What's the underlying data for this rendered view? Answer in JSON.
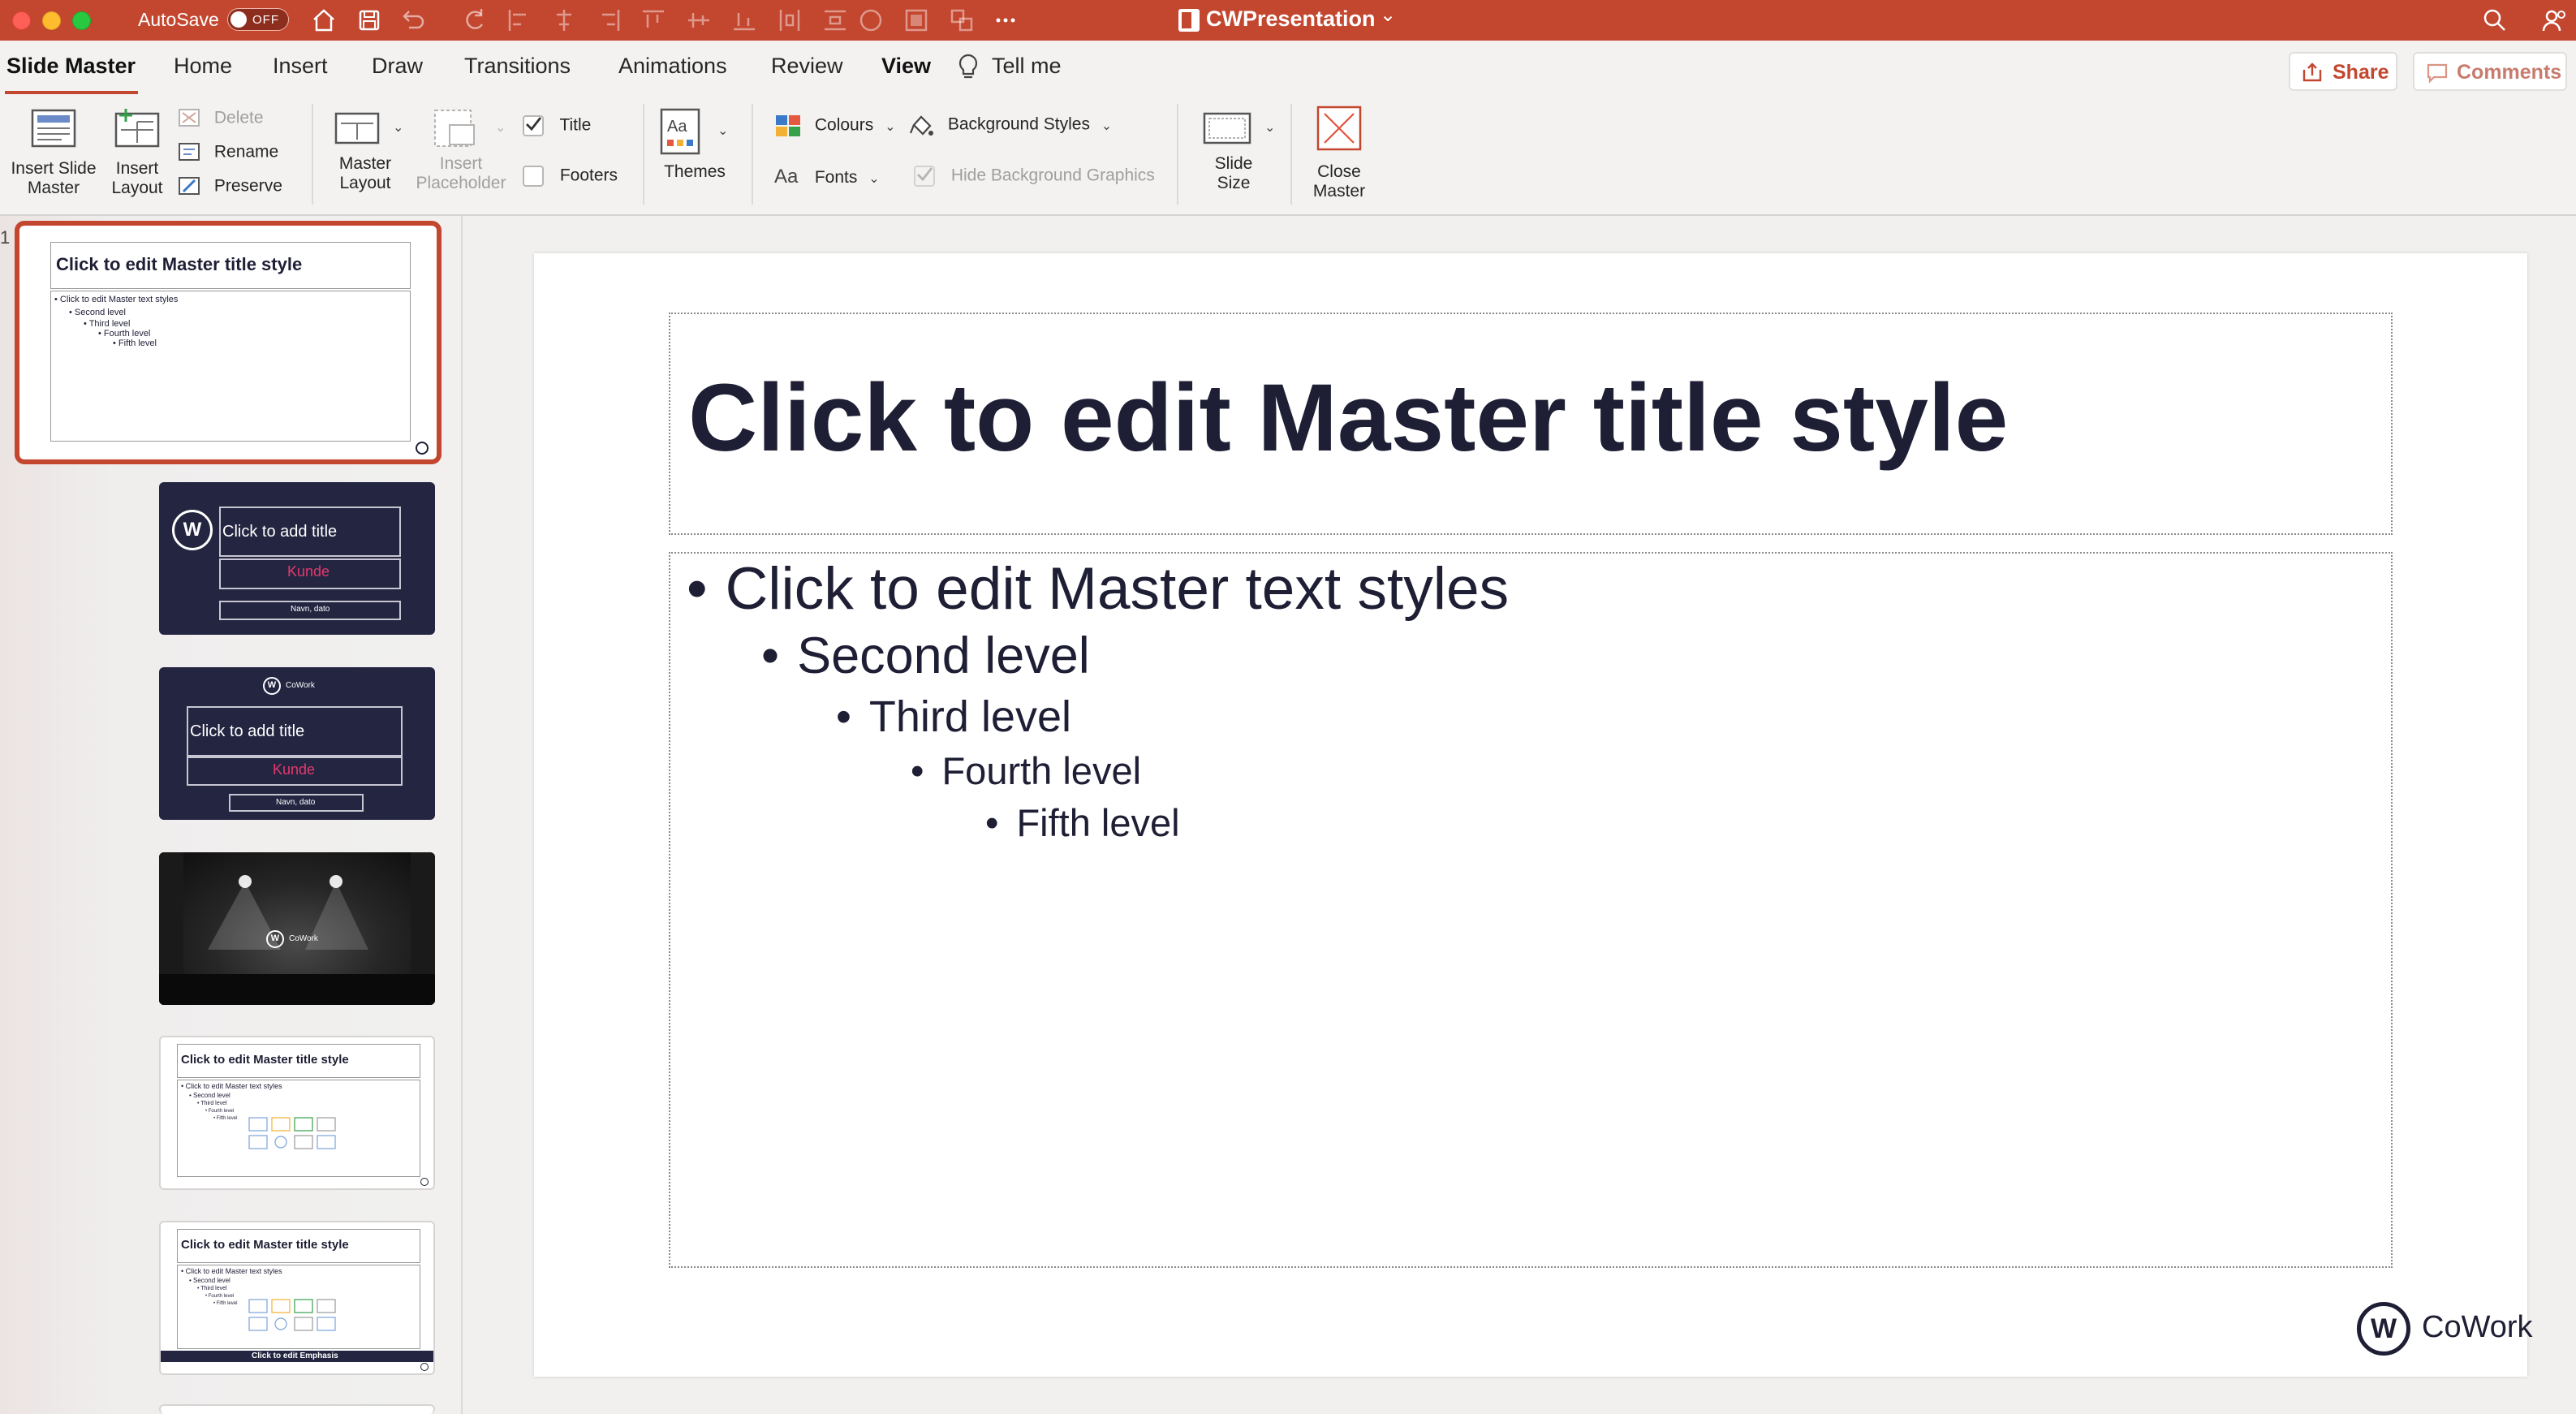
{
  "window": {
    "autosave_label": "AutoSave",
    "autosave_state": "OFF",
    "document_title": "CWPresentation",
    "title_caret": "⌄"
  },
  "tabs": [
    {
      "label": "Slide Master",
      "active": true
    },
    {
      "label": "Home"
    },
    {
      "label": "Insert"
    },
    {
      "label": "Draw"
    },
    {
      "label": "Transitions"
    },
    {
      "label": "Animations"
    },
    {
      "label": "Review"
    },
    {
      "label": "View"
    },
    {
      "label": "Tell me"
    }
  ],
  "share_label": "Share",
  "comments_label": "Comments",
  "ribbon": {
    "insert_slide_master": [
      "Insert Slide",
      "Master"
    ],
    "insert_layout": [
      "Insert",
      "Layout"
    ],
    "delete": "Delete",
    "rename": "Rename",
    "preserve": "Preserve",
    "master_layout": [
      "Master",
      "Layout"
    ],
    "insert_placeholder": [
      "Insert",
      "Placeholder"
    ],
    "title_check": "Title",
    "footers_check": "Footers",
    "themes": "Themes",
    "colours": "Colours",
    "fonts": "Fonts",
    "background_styles": "Background Styles",
    "hide_background_graphics": "Hide Background Graphics",
    "slide_size": [
      "Slide",
      "Size"
    ],
    "close_master": [
      "Close",
      "Master"
    ]
  },
  "thumbnails": {
    "slide_number": "1",
    "master": {
      "title": "Click to edit Master title style",
      "levels": [
        "• Click to edit Master text styles",
        "• Second level",
        "• Third level",
        "• Fourth level",
        "• Fifth level"
      ]
    },
    "layout2": {
      "title": "Click to add title",
      "kunde": "Kunde",
      "date": "Navn, dato",
      "logo": "W"
    },
    "layout3": {
      "title": "Click to add title",
      "kunde": "Kunde",
      "date": "Navn, dato",
      "logo": "W",
      "brand": "CoWork"
    },
    "layout4": {
      "logo": "W",
      "brand": "CoWork"
    },
    "layout5": {
      "title": "Click to edit Master title style",
      "levels": [
        "• Click to edit Master text styles",
        "• Second level",
        "• Third level",
        "• Fourth level",
        "• Fifth level"
      ]
    },
    "layout6": {
      "title": "Click to edit Master title style",
      "levels": [
        "• Click to edit Master text styles",
        "• Second level",
        "• Third level",
        "• Fourth level",
        "• Fifth level"
      ],
      "emphasis": "Click to edit Emphasis"
    }
  },
  "slide": {
    "title": "Click to edit Master title style",
    "levels": [
      "Click to edit Master text styles",
      "Second level",
      "Third level",
      "Fourth level",
      "Fifth level"
    ],
    "bullet": "•",
    "logo_letter": "W",
    "logo_text": "CoWork"
  },
  "colors": {
    "accent": "#c3462f",
    "slide_text": "#1e1e35",
    "dark_bg": "#242541",
    "kunde": "#e23a6c"
  }
}
